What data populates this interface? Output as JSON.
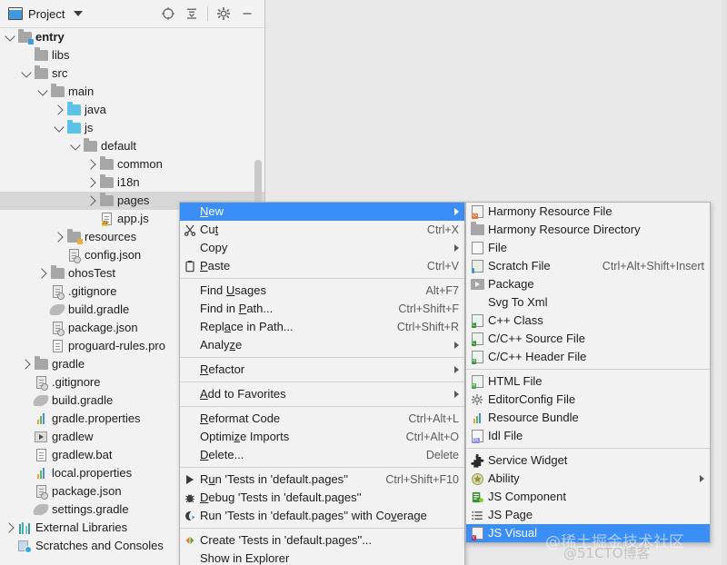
{
  "window": {
    "panel_title": "Project",
    "toolbar_icons": [
      "locate-icon",
      "collapse-all-icon",
      "settings-gear-icon",
      "minimize-icon"
    ]
  },
  "tree": {
    "items": [
      {
        "label": "entry",
        "depth": 1,
        "arrow": "down",
        "icon": "folder-module-blue",
        "bold": true,
        "selected": false
      },
      {
        "label": "libs",
        "depth": 2,
        "arrow": "none",
        "icon": "folder-grey",
        "bold": false,
        "selected": false
      },
      {
        "label": "src",
        "depth": 2,
        "arrow": "down",
        "icon": "folder-grey",
        "bold": false,
        "selected": false
      },
      {
        "label": "main",
        "depth": 3,
        "arrow": "down",
        "icon": "folder-grey",
        "bold": false,
        "selected": false
      },
      {
        "label": "java",
        "depth": 4,
        "arrow": "right",
        "icon": "folder-source-blue",
        "bold": false,
        "selected": false
      },
      {
        "label": "js",
        "depth": 4,
        "arrow": "down",
        "icon": "folder-source-blue",
        "bold": false,
        "selected": false
      },
      {
        "label": "default",
        "depth": 5,
        "arrow": "down",
        "icon": "folder-grey",
        "bold": false,
        "selected": false
      },
      {
        "label": "common",
        "depth": 6,
        "arrow": "right",
        "icon": "folder-grey",
        "bold": false,
        "selected": false
      },
      {
        "label": "i18n",
        "depth": 6,
        "arrow": "right",
        "icon": "folder-grey",
        "bold": false,
        "selected": false
      },
      {
        "label": "pages",
        "depth": 6,
        "arrow": "right",
        "icon": "folder-grey",
        "bold": false,
        "selected": true
      },
      {
        "label": "app.js",
        "depth": 6,
        "arrow": "none",
        "icon": "js-file",
        "bold": false,
        "selected": false
      },
      {
        "label": "resources",
        "depth": 4,
        "arrow": "right",
        "icon": "folder-resource",
        "bold": false,
        "selected": false
      },
      {
        "label": "config.json",
        "depth": 4,
        "arrow": "none",
        "icon": "json-file",
        "bold": false,
        "selected": false
      },
      {
        "label": "ohosTest",
        "depth": 3,
        "arrow": "right",
        "icon": "folder-grey",
        "bold": false,
        "selected": false
      },
      {
        "label": ".gitignore",
        "depth": 3,
        "arrow": "none",
        "icon": "gitignore-file",
        "bold": false,
        "selected": false
      },
      {
        "label": "build.gradle",
        "depth": 3,
        "arrow": "none",
        "icon": "gradle-file",
        "bold": false,
        "selected": false
      },
      {
        "label": "package.json",
        "depth": 3,
        "arrow": "none",
        "icon": "json-file",
        "bold": false,
        "selected": false
      },
      {
        "label": "proguard-rules.pro",
        "depth": 3,
        "arrow": "none",
        "icon": "text-file",
        "bold": false,
        "selected": false
      },
      {
        "label": "gradle",
        "depth": 2,
        "arrow": "right",
        "icon": "folder-grey",
        "bold": false,
        "selected": false
      },
      {
        "label": ".gitignore",
        "depth": 2,
        "arrow": "none",
        "icon": "gitignore-file",
        "bold": false,
        "selected": false
      },
      {
        "label": "build.gradle",
        "depth": 2,
        "arrow": "none",
        "icon": "gradle-file",
        "bold": false,
        "selected": false
      },
      {
        "label": "gradle.properties",
        "depth": 2,
        "arrow": "none",
        "icon": "properties-file",
        "bold": false,
        "selected": false
      },
      {
        "label": "gradlew",
        "depth": 2,
        "arrow": "none",
        "icon": "script-file",
        "bold": false,
        "selected": false
      },
      {
        "label": "gradlew.bat",
        "depth": 2,
        "arrow": "none",
        "icon": "text-file",
        "bold": false,
        "selected": false
      },
      {
        "label": "local.properties",
        "depth": 2,
        "arrow": "none",
        "icon": "properties-file",
        "bold": false,
        "selected": false
      },
      {
        "label": "package.json",
        "depth": 2,
        "arrow": "none",
        "icon": "json-file",
        "bold": false,
        "selected": false
      },
      {
        "label": "settings.gradle",
        "depth": 2,
        "arrow": "none",
        "icon": "gradle-file",
        "bold": false,
        "selected": false
      },
      {
        "label": "External Libraries",
        "depth": 1,
        "arrow": "right",
        "icon": "libraries-icon",
        "bold": false,
        "selected": false
      },
      {
        "label": "Scratches and Consoles",
        "depth": 1,
        "arrow": "none",
        "icon": "scratches-icon",
        "bold": false,
        "selected": false
      }
    ]
  },
  "context_menu": {
    "items": [
      {
        "type": "item",
        "label": "New",
        "mnemonic": "N",
        "accel": "",
        "icon": "",
        "submenu": true,
        "highlight": true
      },
      {
        "type": "item",
        "label": "Cut",
        "mnemonic": "t",
        "accel": "Ctrl+X",
        "icon": "cut-icon",
        "submenu": false,
        "highlight": false
      },
      {
        "type": "item",
        "label": "Copy",
        "mnemonic": "",
        "accel": "",
        "icon": "",
        "submenu": true,
        "highlight": false
      },
      {
        "type": "item",
        "label": "Paste",
        "mnemonic": "P",
        "accel": "Ctrl+V",
        "icon": "paste-icon",
        "submenu": false,
        "highlight": false
      },
      {
        "type": "sep"
      },
      {
        "type": "item",
        "label": "Find Usages",
        "mnemonic": "U",
        "accel": "Alt+F7",
        "icon": "",
        "submenu": false,
        "highlight": false
      },
      {
        "type": "item",
        "label": "Find in Path...",
        "mnemonic": "P",
        "accel": "Ctrl+Shift+F",
        "icon": "",
        "submenu": false,
        "highlight": false
      },
      {
        "type": "item",
        "label": "Replace in Path...",
        "mnemonic": "a",
        "accel": "Ctrl+Shift+R",
        "icon": "",
        "submenu": false,
        "highlight": false
      },
      {
        "type": "item",
        "label": "Analyze",
        "mnemonic": "z",
        "accel": "",
        "icon": "",
        "submenu": true,
        "highlight": false
      },
      {
        "type": "sep"
      },
      {
        "type": "item",
        "label": "Refactor",
        "mnemonic": "R",
        "accel": "",
        "icon": "",
        "submenu": true,
        "highlight": false
      },
      {
        "type": "sep"
      },
      {
        "type": "item",
        "label": "Add to Favorites",
        "mnemonic": "A",
        "accel": "",
        "icon": "",
        "submenu": true,
        "highlight": false
      },
      {
        "type": "sep"
      },
      {
        "type": "item",
        "label": "Reformat Code",
        "mnemonic": "R",
        "accel": "Ctrl+Alt+L",
        "icon": "",
        "submenu": false,
        "highlight": false
      },
      {
        "type": "item",
        "label": "Optimize Imports",
        "mnemonic": "z",
        "accel": "Ctrl+Alt+O",
        "icon": "",
        "submenu": false,
        "highlight": false
      },
      {
        "type": "item",
        "label": "Delete...",
        "mnemonic": "D",
        "accel": "Delete",
        "icon": "",
        "submenu": false,
        "highlight": false
      },
      {
        "type": "sep"
      },
      {
        "type": "item",
        "label": "Run 'Tests in 'default.pages''",
        "mnemonic": "u",
        "accel": "Ctrl+Shift+F10",
        "icon": "run-icon",
        "submenu": false,
        "highlight": false
      },
      {
        "type": "item",
        "label": "Debug 'Tests in 'default.pages''",
        "mnemonic": "D",
        "accel": "",
        "icon": "debug-icon",
        "submenu": false,
        "highlight": false
      },
      {
        "type": "item",
        "label": "Run 'Tests in 'default.pages'' with Coverage",
        "mnemonic": "v",
        "accel": "",
        "icon": "coverage-icon",
        "submenu": false,
        "highlight": false
      },
      {
        "type": "sep"
      },
      {
        "type": "item",
        "label": "Create 'Tests in 'default.pages''...",
        "mnemonic": "",
        "accel": "",
        "icon": "create-icon",
        "submenu": false,
        "highlight": false
      },
      {
        "type": "item",
        "label": "Show in Explorer",
        "mnemonic": "",
        "accel": "",
        "icon": "",
        "submenu": false,
        "highlight": false
      }
    ]
  },
  "submenu": {
    "items": [
      {
        "type": "item",
        "label": "Harmony Resource File",
        "accel": "",
        "icon": "harmony-resource-file-icon",
        "submenu": false,
        "highlight": false
      },
      {
        "type": "item",
        "label": "Harmony Resource Directory",
        "accel": "",
        "icon": "harmony-resource-directory-icon",
        "submenu": false,
        "highlight": false
      },
      {
        "type": "item",
        "label": "File",
        "accel": "",
        "icon": "file-icon",
        "submenu": false,
        "highlight": false
      },
      {
        "type": "item",
        "label": "Scratch File",
        "accel": "Ctrl+Alt+Shift+Insert",
        "icon": "scratch-file-icon",
        "submenu": false,
        "highlight": false
      },
      {
        "type": "item",
        "label": "Package",
        "accel": "",
        "icon": "package-icon",
        "submenu": false,
        "highlight": false
      },
      {
        "type": "item",
        "label": "Svg To Xml",
        "accel": "",
        "icon": "",
        "submenu": false,
        "highlight": false
      },
      {
        "type": "item",
        "label": "C++ Class",
        "accel": "",
        "icon": "cpp-class-icon",
        "submenu": false,
        "highlight": false
      },
      {
        "type": "item",
        "label": "C/C++ Source File",
        "accel": "",
        "icon": "cpp-source-icon",
        "submenu": false,
        "highlight": false
      },
      {
        "type": "item",
        "label": "C/C++ Header File",
        "accel": "",
        "icon": "cpp-header-icon",
        "submenu": false,
        "highlight": false
      },
      {
        "type": "sep"
      },
      {
        "type": "item",
        "label": "HTML File",
        "accel": "",
        "icon": "html-file-icon",
        "submenu": false,
        "highlight": false
      },
      {
        "type": "item",
        "label": "EditorConfig File",
        "accel": "",
        "icon": "gear-icon",
        "submenu": false,
        "highlight": false
      },
      {
        "type": "item",
        "label": "Resource Bundle",
        "accel": "",
        "icon": "resource-bundle-icon",
        "submenu": false,
        "highlight": false
      },
      {
        "type": "item",
        "label": "Idl File",
        "accel": "",
        "icon": "idl-file-icon",
        "submenu": false,
        "highlight": false
      },
      {
        "type": "sep"
      },
      {
        "type": "item",
        "label": "Service Widget",
        "accel": "",
        "icon": "puzzle-icon",
        "submenu": false,
        "highlight": false
      },
      {
        "type": "item",
        "label": "Ability",
        "accel": "",
        "icon": "ability-icon",
        "submenu": true,
        "highlight": false
      },
      {
        "type": "item",
        "label": "JS Component",
        "accel": "",
        "icon": "js-component-icon",
        "submenu": false,
        "highlight": false
      },
      {
        "type": "item",
        "label": "JS Page",
        "accel": "",
        "icon": "js-page-icon",
        "submenu": false,
        "highlight": false
      },
      {
        "type": "item",
        "label": "JS Visual",
        "accel": "",
        "icon": "js-visual-icon",
        "submenu": false,
        "highlight": true
      }
    ]
  },
  "watermark": {
    "primary": "@稀土掘金技术社区",
    "secondary": "@51CTO博客"
  },
  "colors": {
    "accent_blue": "#3a8ef7",
    "panel_bg": "#f2f2f2",
    "editor_bg": "#e9e9e9",
    "selection_grey": "#d7d7d7"
  }
}
